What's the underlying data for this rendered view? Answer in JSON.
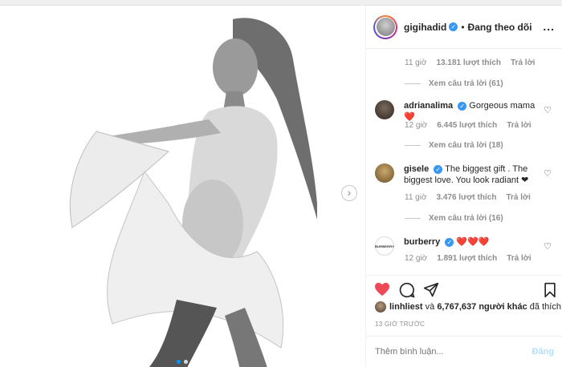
{
  "header": {
    "username": "gigihadid",
    "separator": "•",
    "follow_status": "Đang theo dõi",
    "more": "..."
  },
  "comments": {
    "first_meta": {
      "time": "11 giờ",
      "likes": "13.181 lượt thích",
      "reply": "Trả lời"
    },
    "first_view_replies": "Xem câu trả lời (61)",
    "items": [
      {
        "user": "adrianalima",
        "text": "Gorgeous mama ❤️",
        "time": "12 giờ",
        "likes": "6.445 lượt thích",
        "reply": "Trả lời",
        "view_replies": "Xem câu trả lời (18)"
      },
      {
        "user": "gisele",
        "text": "The biggest gift . The biggest love. You look radiant ❤",
        "time": "11 giờ",
        "likes": "3.476 lượt thích",
        "reply": "Trả lời",
        "view_replies": "Xem câu trả lời (16)"
      },
      {
        "user": "burberry",
        "text": "❤️❤️❤️",
        "time": "12 giờ",
        "likes": "1.891 lượt thích",
        "reply": "Trả lời"
      }
    ]
  },
  "liked_by": {
    "user": "linhliest",
    "conj": "và",
    "count": "6,767,637",
    "others": "người khác",
    "verb": "đã thích"
  },
  "timeago": "13 GIỜ TRƯỚC",
  "add_comment": {
    "placeholder": "Thêm bình luận...",
    "post": "Đăng"
  },
  "colors": {
    "heart": "#ed4956",
    "verified": "#3897f0",
    "post_disabled": "#b2dffc"
  }
}
